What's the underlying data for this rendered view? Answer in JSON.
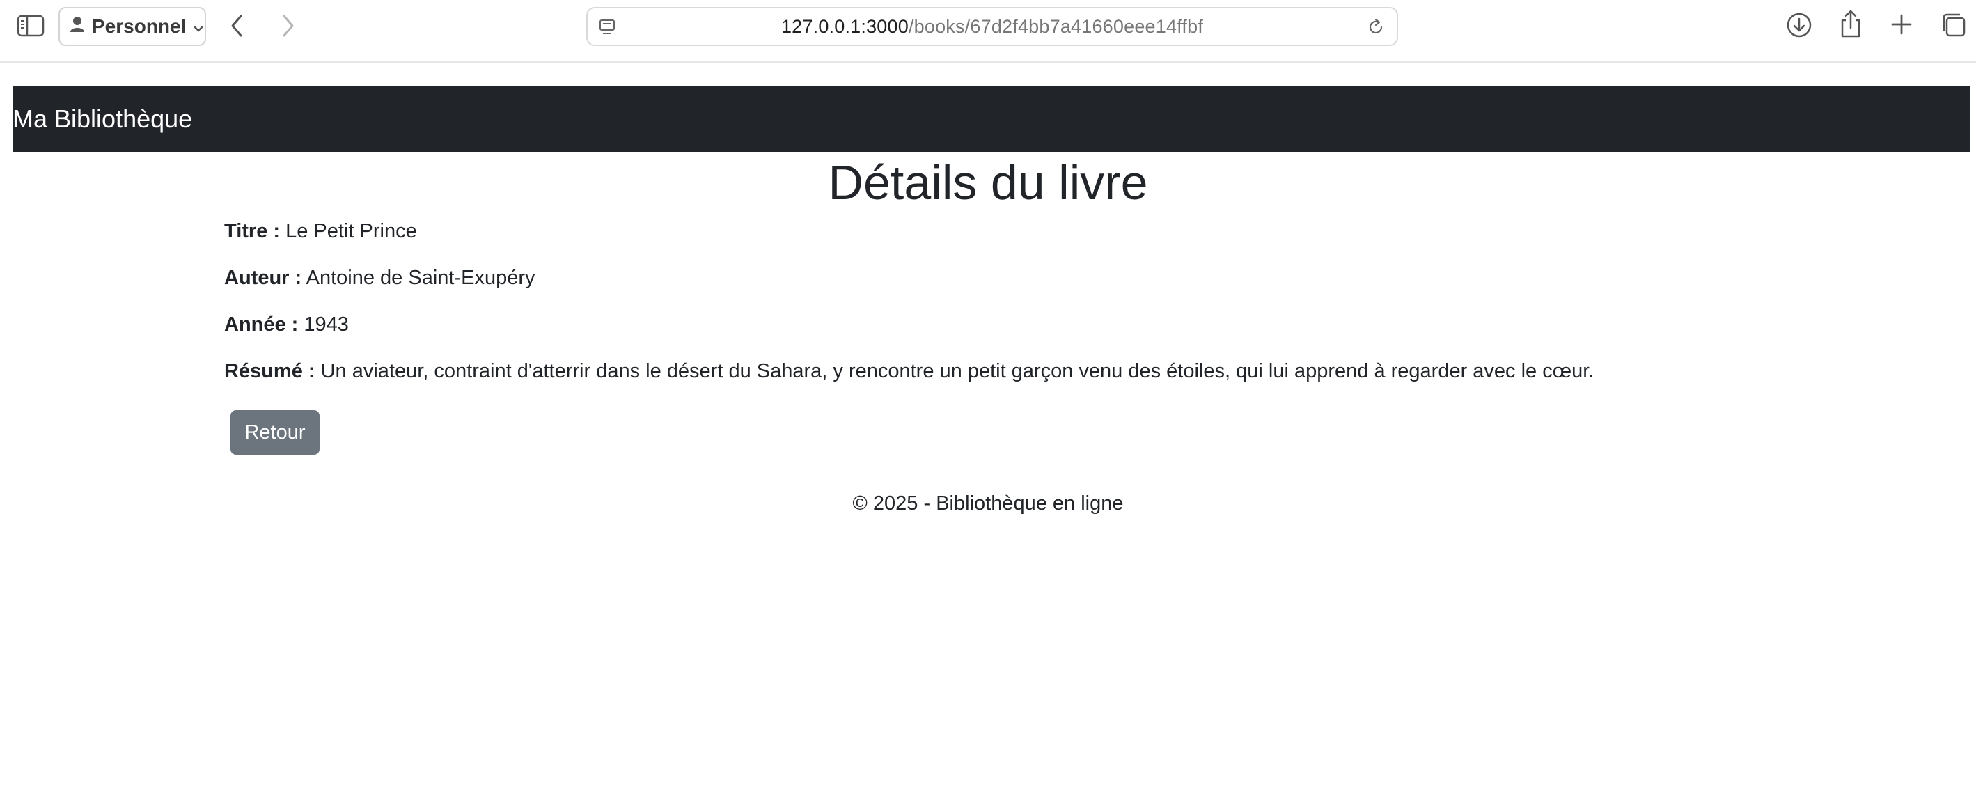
{
  "browser": {
    "profile_label": "Personnel",
    "url_host": "127.0.0.1:3000",
    "url_path": "/books/67d2f4bb7a41660eee14ffbf",
    "icons": [
      "sidebar-icon",
      "person-icon",
      "chevron-down-icon",
      "back-icon",
      "forward-icon",
      "site-info-icon",
      "reload-icon",
      "download-icon",
      "share-icon",
      "new-tab-icon",
      "tabs-overview-icon"
    ]
  },
  "navbar": {
    "brand": "Ma Bibliothèque",
    "background": "#212529"
  },
  "page": {
    "title": "Détails du livre",
    "fields": [
      {
        "label": "Titre :",
        "value": "Le Petit Prince"
      },
      {
        "label": "Auteur :",
        "value": "Antoine de Saint-Exupéry"
      },
      {
        "label": "Année :",
        "value": "1943"
      },
      {
        "label": "Résumé :",
        "value": "Un aviateur, contraint d'atterrir dans le désert du Sahara, y rencontre un petit garçon venu des étoiles, qui lui apprend à regarder avec le cœur."
      }
    ],
    "back_button": "Retour",
    "back_button_color": "#6c757d"
  },
  "footer": {
    "text": "© 2025 - Bibliothèque en ligne"
  }
}
